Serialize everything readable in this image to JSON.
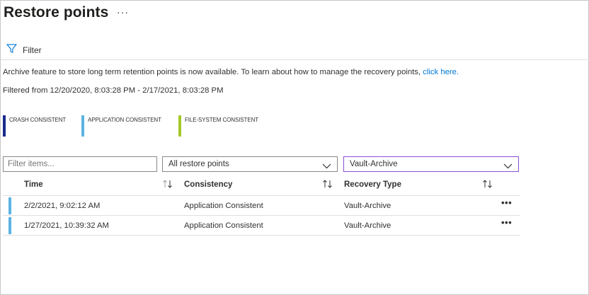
{
  "header": {
    "title": "Restore points",
    "more_label": "···"
  },
  "toolbar": {
    "filter_label": "Filter",
    "filter_icon": "filter-funnel-icon"
  },
  "info": {
    "message": "Archive feature to store long term retention points is now available. To learn about how to manage the recovery points, ",
    "link_text": "click here."
  },
  "filtered_range": "Filtered from 12/20/2020, 8:03:28 PM - 2/17/2021, 8:03:28 PM",
  "legend": [
    {
      "label": "CRASH CONSISTENT",
      "color": "#1a2a8a"
    },
    {
      "label": "APPLICATION CONSISTENT",
      "color": "#5cb3e2"
    },
    {
      "label": "FILE-SYSTEM CONSISTENT",
      "color": "#a6c92a"
    }
  ],
  "filters": {
    "search_placeholder": "Filter items...",
    "restore_points_value": "All restore points",
    "recovery_type_value": "Vault-Archive"
  },
  "table": {
    "columns": [
      "Time",
      "Consistency",
      "Recovery Type"
    ],
    "rows": [
      {
        "time": "2/2/2021, 9:02:12 AM",
        "consistency": "Application Consistent",
        "recovery_type": "Vault-Archive",
        "more": "•••"
      },
      {
        "time": "1/27/2021, 10:39:32 AM",
        "consistency": "Application Consistent",
        "recovery_type": "Vault-Archive",
        "more": "•••"
      }
    ]
  },
  "colors": {
    "accent_link": "#0078d4",
    "dropdown_focus_border": "#8a4fd6",
    "row_indicator": "#5cb3e2"
  }
}
